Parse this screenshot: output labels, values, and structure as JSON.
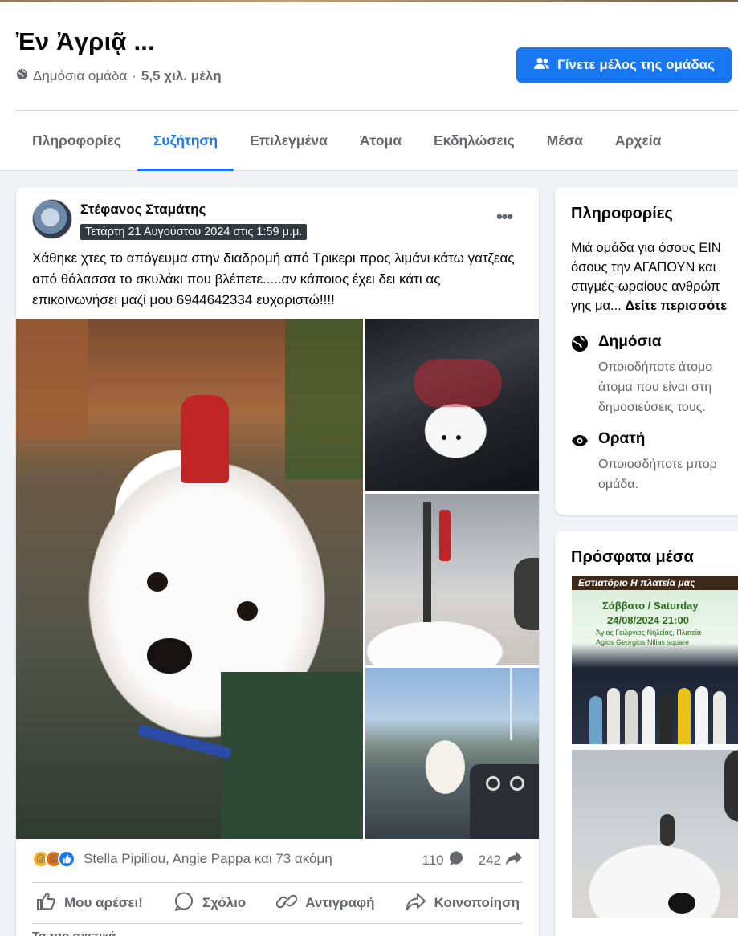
{
  "group": {
    "title": "Ἐν Ἀγριᾷ ...",
    "privacy": "Δημόσια ομάδα",
    "separator": "·",
    "members": "5,5 χιλ. μέλη",
    "join_label": "Γίνετε μέλος της ομάδας"
  },
  "tabs": [
    {
      "label": "Πληροφορίες",
      "active": false
    },
    {
      "label": "Συζήτηση",
      "active": true
    },
    {
      "label": "Επιλεγμένα",
      "active": false
    },
    {
      "label": "Άτομα",
      "active": false
    },
    {
      "label": "Εκδηλώσεις",
      "active": false
    },
    {
      "label": "Μέσα",
      "active": false
    },
    {
      "label": "Αρχεία",
      "active": false
    }
  ],
  "post": {
    "author": "Στέφανος Σταμάτης",
    "timestamp": "Τετάρτη 21 Αυγούστου 2024 στις 1:59 μ.μ.",
    "text": "Χάθηκε χτες το απόγευμα στην διαδρομή από Τρικερι προς λιμάνι κάτω γατζεας από θάλασσα το σκυλάκι που βλέπετε.....αν κάποιος έχει δει κάτι ας επικοινωνήσει μαζί μου 6944642334 ευχαριστώ!!!!",
    "reactions_text": "Stella Pipiliou, Angie Pappa και 73 ακόμη",
    "reaction_icons": [
      "sad-reaction",
      "angry-reaction",
      "like-reaction"
    ],
    "comments_count": "110",
    "shares_count": "242",
    "actions": {
      "like": "Μου αρέσει!",
      "comment": "Σχόλιο",
      "copy": "Αντιγραφή",
      "share": "Κοινοποίηση"
    },
    "most_relevant": "Τα πιο σχετικά"
  },
  "about": {
    "title": "Πληροφορίες",
    "desc_lines": [
      "Μιά ομάδα για όσους ΕΙΝ",
      "όσους την ΑΓΑΠΟΥΝ και",
      "στιγμές-ωραίους ανθρώπ",
      "γης μα..."
    ],
    "see_more": "Δείτε περισσότε",
    "public_label": "Δημόσια",
    "public_sub_lines": [
      "Οποιοδήποτε άτομο",
      "άτομα που είναι στη",
      "δημοσιεύσεις τους."
    ],
    "visible_label": "Ορατή",
    "visible_sub_lines": [
      "Οποιοσδήποτε μπορ",
      "ομάδα."
    ]
  },
  "recent_media": {
    "title": "Πρόσφατα μέσα",
    "poster_banner": "Εστιατόριο Η πλατεία μας",
    "poster_date": "Σάββατο / Saturday",
    "poster_time": "24/08/2024   21:00",
    "poster_sub1": "Άγιος Γεώργιος Νηλείας, Πλατεία",
    "poster_sub2": "Agios Georgios Nilias square"
  },
  "colors": {
    "accent": "#1877f2",
    "secondary_text": "#65676b",
    "background": "#f0f2f5"
  }
}
